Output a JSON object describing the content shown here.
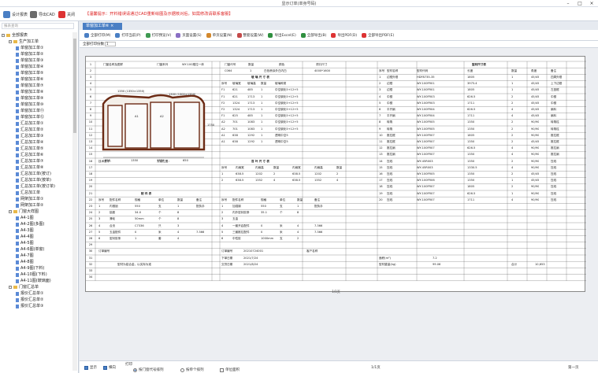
{
  "window": {
    "title": "显示订单(单身号码)"
  },
  "toolbar": {
    "design_label": "设计报表",
    "export_label": "导出CAD",
    "close_label": "关闭",
    "notice": "【温馨提示：开料错误请通过CAD重新绘图及示据核对后，如需修改请联系客服】"
  },
  "sidebar": {
    "search_placeholder": "报表查询",
    "tree": [
      {
        "label": "全部报表",
        "level": 0,
        "kind": "root"
      },
      {
        "label": "生产加工单",
        "level": 1,
        "kind": "folder"
      },
      {
        "label": "单窗加工单①",
        "level": 2,
        "kind": "doc"
      },
      {
        "label": "单窗加工单②",
        "level": 2,
        "kind": "doc"
      },
      {
        "label": "单窗加工单③",
        "level": 2,
        "kind": "doc"
      },
      {
        "label": "单窗加工单④",
        "level": 2,
        "kind": "doc"
      },
      {
        "label": "单窗加工单⑤",
        "level": 2,
        "kind": "doc"
      },
      {
        "label": "单窗加工单⑥",
        "level": 2,
        "kind": "doc"
      },
      {
        "label": "单窗加工单⑦",
        "level": 2,
        "kind": "doc"
      },
      {
        "label": "单窗加工单⑧",
        "level": 2,
        "kind": "doc"
      },
      {
        "label": "单窗加工单⑨",
        "level": 2,
        "kind": "doc"
      },
      {
        "label": "单窗加工单⑩",
        "level": 2,
        "kind": "doc"
      },
      {
        "label": "单窗加工单⑪",
        "level": 2,
        "kind": "doc"
      },
      {
        "label": "单窗加工单⑫",
        "level": 2,
        "kind": "doc"
      },
      {
        "label": "汇总加工单①",
        "level": 2,
        "kind": "doc"
      },
      {
        "label": "汇总加工单②",
        "level": 2,
        "kind": "doc"
      },
      {
        "label": "汇总加工单③",
        "level": 2,
        "kind": "doc"
      },
      {
        "label": "汇总加工单④",
        "level": 2,
        "kind": "doc"
      },
      {
        "label": "汇总加工单⑤",
        "level": 2,
        "kind": "doc"
      },
      {
        "label": "汇总加工单⑥",
        "level": 2,
        "kind": "doc"
      },
      {
        "label": "汇总加工单⑦",
        "level": 2,
        "kind": "doc"
      },
      {
        "label": "汇总加工单⑧",
        "level": 2,
        "kind": "doc"
      },
      {
        "label": "汇总加工单(按订)",
        "level": 2,
        "kind": "doc"
      },
      {
        "label": "汇总加工单(按单)",
        "level": 2,
        "kind": "doc"
      },
      {
        "label": "汇总加工单(按订单)",
        "level": 2,
        "kind": "doc"
      },
      {
        "label": "汇总加工单",
        "level": 2,
        "kind": "doc"
      },
      {
        "label": "网架加工单①",
        "level": 2,
        "kind": "doc"
      },
      {
        "label": "网架加工单②",
        "level": 2,
        "kind": "doc"
      },
      {
        "label": "门窗大样图",
        "level": 1,
        "kind": "folder"
      },
      {
        "label": "A4-1图",
        "level": 2,
        "kind": "doc"
      },
      {
        "label": "A4-2图(多图)",
        "level": 2,
        "kind": "doc"
      },
      {
        "label": "A4-3图",
        "level": 2,
        "kind": "doc"
      },
      {
        "label": "A4-4图",
        "level": 2,
        "kind": "doc"
      },
      {
        "label": "A4-5图",
        "level": 2,
        "kind": "doc"
      },
      {
        "label": "A4-6图(单窗)",
        "level": 2,
        "kind": "doc"
      },
      {
        "label": "A4-7图",
        "level": 2,
        "kind": "doc"
      },
      {
        "label": "A4-8图",
        "level": 2,
        "kind": "doc"
      },
      {
        "label": "A4-9图(下料)",
        "level": 2,
        "kind": "doc"
      },
      {
        "label": "A4-10图(下料)",
        "level": 2,
        "kind": "doc"
      },
      {
        "label": "A4-11图(玻璃面)",
        "level": 2,
        "kind": "doc"
      },
      {
        "label": "门窗汇总单",
        "level": 1,
        "kind": "folder"
      },
      {
        "label": "报价汇总单①",
        "level": 2,
        "kind": "doc"
      },
      {
        "label": "报价汇总单②",
        "level": 2,
        "kind": "doc"
      },
      {
        "label": "报价汇总单③",
        "level": 2,
        "kind": "doc"
      }
    ]
  },
  "tabs": {
    "active": "单窗加工单⑥"
  },
  "report_toolbar": [
    {
      "label": "全部打印(M)",
      "icon": "print-all-icon",
      "color": "#4a7fc4"
    },
    {
      "label": "打印当前(P)",
      "icon": "print-icon",
      "color": "#4a7fc4"
    },
    {
      "label": "打印预览(V)",
      "icon": "preview-icon",
      "color": "#3f9a52"
    },
    {
      "label": "页面设置(S)",
      "icon": "page-setup-icon",
      "color": "#8a6fc4"
    },
    {
      "label": "单页设置(N)",
      "icon": "single-page-icon",
      "color": "#d3882c"
    },
    {
      "label": "整套设置(W)",
      "icon": "set-setup-icon",
      "color": "#c44a4a"
    },
    {
      "label": "导出Excel(E)",
      "icon": "excel-icon",
      "color": "#2f8f3f"
    },
    {
      "label": "全部导出(B)",
      "icon": "export-all-icon",
      "color": "#2f8f3f"
    },
    {
      "label": "导出PDF(D)",
      "icon": "pdf-icon",
      "color": "#d33"
    },
    {
      "label": "全部导出PDF(E)",
      "icon": "pdf-all-icon",
      "color": "#d33"
    }
  ],
  "subbar": {
    "label": "全部打印份数：",
    "value": "1"
  },
  "report": {
    "header": {
      "name_label": "门窗名称及图样",
      "series_label": "门窗系列",
      "series_value": "WY-100推拉一体",
      "code_label": "门窗代号",
      "qty_label": "数量",
      "color_label": "颜色",
      "size_label": "洞口尺寸",
      "code_value": "C064",
      "qty_value": "1",
      "color_value": "白色喷涂外白内白",
      "size_value": "4000*1600",
      "material_label": "型材尺寸表"
    },
    "dims": {
      "top_a": "1350 (1350×1350)",
      "top_b": "1300 (1300×1350)",
      "bottom": [
        "650",
        "1350",
        "1350",
        "650"
      ],
      "side": "1750",
      "label_a": "A1",
      "label_b": "A2"
    },
    "glass_title": "玻 璃 尺 寸 表",
    "glass_cols": [
      "序号",
      "玻璃宽",
      "玻璃高",
      "数量",
      "玻璃种类"
    ],
    "glass_rows": [
      [
        "F1",
        "621",
        "485",
        "1",
        "中空钢化5+12+5"
      ],
      [
        "F1",
        "621",
        "1713",
        "1",
        "中空钢化5+12+5"
      ],
      [
        "F2",
        "1324",
        "1713",
        "1",
        "中空钢化5+12+5"
      ],
      [
        "F2",
        "1324",
        "1713",
        "1",
        "中空钢化5+12+5"
      ],
      [
        "F1",
        "625",
        "485",
        "1",
        "中空钢化5+12+5"
      ],
      [
        "A2",
        "701",
        "1083",
        "1",
        "中空钢化5+12+5"
      ],
      [
        "A2",
        "701",
        "1083",
        "1",
        "中空钢化5+12+5"
      ],
      [
        "A1",
        "638",
        "1292",
        "1",
        "透明中空5"
      ],
      [
        "A1",
        "638",
        "1292",
        "1",
        "透明中空5"
      ]
    ],
    "profile_cols": [
      "序号",
      "型材名称",
      "型材代码",
      "长度",
      "数量",
      "角度",
      "备注"
    ],
    "profile_rows": [
      [
        "1",
        "边框外框",
        "HDF8735-35",
        "1805",
        "1",
        "45/45",
        "四周外框"
      ],
      [
        "2",
        "边框",
        "WY-100FR01",
        "3975.4",
        "1",
        "45/45",
        "上下边框"
      ],
      [
        "3",
        "边框",
        "WY-100FR01",
        "1805",
        "1",
        "45/45",
        "左竖框"
      ],
      [
        "4",
        "中梃",
        "WY-100FR03",
        "626.5",
        "2",
        "45/45",
        "中梃"
      ],
      [
        "5",
        "中梃",
        "WY-100FR03",
        "1711",
        "2",
        "45/45",
        "中梃"
      ],
      [
        "6",
        "平开扇",
        "WY-100FR04",
        "626.5",
        "4",
        "45/45",
        "扇料"
      ],
      [
        "7",
        "平开扇",
        "WY-100FR04",
        "1711",
        "4",
        "45/45",
        "扇料"
      ],
      [
        "8",
        "转角",
        "WY-100FR05",
        "1350",
        "2",
        "90/90",
        "转角柱"
      ],
      [
        "9",
        "转角",
        "WY-100FR05",
        "1350",
        "2",
        "90/90",
        "转角柱"
      ],
      [
        "10",
        "推拉框",
        "WY-100FR07",
        "1805",
        "2",
        "90/90",
        "推拉框"
      ],
      [
        "11",
        "推拉框",
        "WY-100FR07",
        "1350",
        "2",
        "45/45",
        "推拉框"
      ],
      [
        "12",
        "推拉扇",
        "WY-100FR07",
        "626.5",
        "4",
        "90/90",
        "推拉扇"
      ],
      [
        "13",
        "推拉扇",
        "WY-100FR07",
        "1350",
        "4",
        "90/90",
        "推拉扇"
      ],
      [
        "14",
        "压线",
        "WY-45R003",
        "1350",
        "2",
        "90/90",
        "压线"
      ],
      [
        "15",
        "压线",
        "WY-45R003",
        "1330.5",
        "4",
        "90/90",
        "压线"
      ],
      [
        "16",
        "压线",
        "WY-100FR05",
        "1350",
        "2",
        "45/45",
        "压线"
      ],
      [
        "17",
        "压线",
        "WY-100FR06",
        "1350",
        "1",
        "45/45",
        "压线"
      ],
      [
        "18",
        "压线",
        "WY-100FR07",
        "1805",
        "2",
        "90/90",
        "压线"
      ],
      [
        "19",
        "压线",
        "WY-100FR07",
        "626.5",
        "1",
        "90/90",
        "压线"
      ],
      [
        "20",
        "压线",
        "WY-100FR07",
        "1711",
        "4",
        "90/90",
        "压线"
      ]
    ],
    "mid_left_label": "技术要求：",
    "mid_right_label": "安装位置：",
    "mid_glass_title": "百 叶 尺 寸 表",
    "mid_glass_cols": [
      "序号",
      "内扇宽",
      "内扇高",
      "数量",
      "内扇宽",
      "内扇高",
      "数量"
    ],
    "mid_glass_rows": [
      [
        "1",
        "638.5",
        "1202",
        "2",
        "638.5",
        "1202",
        "2"
      ],
      [
        "2",
        "638.5",
        "1352",
        "4",
        "638.5",
        "1352",
        "4"
      ]
    ],
    "acc_title": "配 件 表",
    "acc_cols": [
      "序号",
      "配件名称",
      "规格",
      "单位",
      "数量",
      "备注"
    ],
    "acc_rows": [
      [
        "1",
        "内推锁",
        "550",
        "支",
        "1",
        "配执手"
      ],
      [
        "2",
        "锁座",
        "34.0",
        "个",
        "8",
        ""
      ],
      [
        "3",
        "滑轮",
        "50mm",
        "个",
        "8",
        ""
      ],
      [
        "4",
        "合页",
        "C7336",
        "只",
        "3",
        ""
      ],
      [
        "5",
        "五金配件",
        "0",
        "米",
        "4",
        "7.366"
      ],
      [
        "6",
        "密封胶条",
        "1",
        "套",
        "4",
        ""
      ]
    ],
    "acc2_cols": [
      "序号",
      "配件名称",
      "规格",
      "单位",
      "数量",
      "备注"
    ],
    "acc2_rows": [
      [
        "1",
        "加强钢",
        "550",
        "支",
        "1",
        "配执手"
      ],
      [
        "2",
        "内外密封胶条",
        "35.1",
        "个",
        "8",
        ""
      ],
      [
        "3",
        "五金",
        "",
        "",
        "",
        ""
      ],
      [
        "4",
        "一套开启配件",
        "0",
        "米",
        "4",
        "7.366"
      ],
      [
        "5",
        "三套推拉配件",
        "0",
        "米",
        "4",
        "7.366"
      ],
      [
        "6",
        "中性胶",
        "1000mm",
        "支",
        "2",
        ""
      ]
    ],
    "footer": {
      "order_label": "订单编号",
      "order_value": "20210724001",
      "date_label": "下单日期",
      "date_value": "2021/7/24",
      "due_label": "交货日期",
      "due_value": "2021/8/24",
      "customer_label": "客户名称",
      "area_label": "面积(m²)",
      "area_value": "7.2",
      "weight_label": "型材重量(kg)",
      "weight_value": "99.06",
      "total_label": "合计",
      "total_value": "10,653",
      "note": "型材为铝合金，以实际为准"
    },
    "page_label": "1/1页"
  },
  "statusbar": {
    "check1": "显示",
    "check2": "横向",
    "group_label": "打印",
    "radio1": "按门窗代号排列",
    "radio2": "按单个排列",
    "radio3": "单位面积",
    "page": "1/1页",
    "nav": "第一页"
  }
}
